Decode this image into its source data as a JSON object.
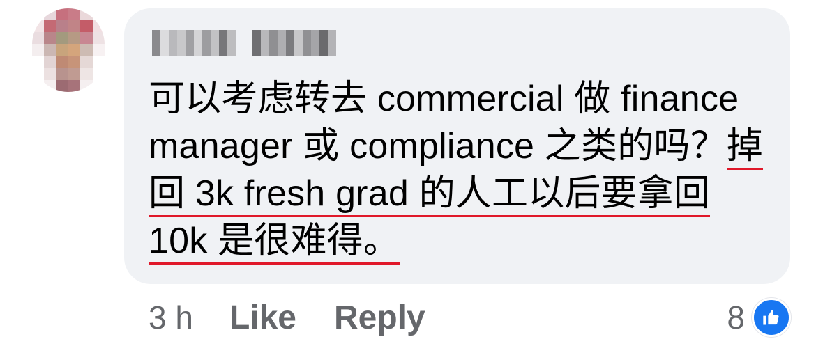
{
  "comment": {
    "author_name": "",
    "text_before": "可以考虑转去 commercial 做 finance manager 或 compliance 之类的吗？",
    "text_highlight": "掉回 3k fresh grad 的人工以后要拿回 10k 是很难得。",
    "timestamp": "3 h",
    "like_label": "Like",
    "reply_label": "Reply",
    "reaction_count": "8",
    "reaction_icon": "thumbs-up-icon"
  },
  "colors": {
    "bubble": "#f0f2f5",
    "action_text": "#65676b",
    "highlight_underline": "#e0182a",
    "reaction_badge": "#1877f2"
  }
}
